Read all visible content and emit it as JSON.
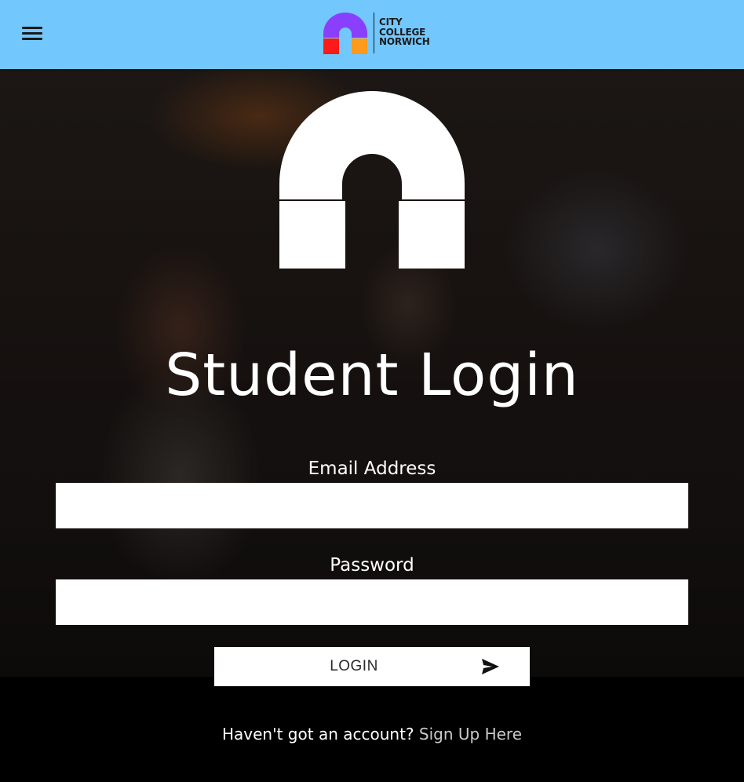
{
  "header": {
    "menu_icon": "hamburger-menu-icon",
    "logo": {
      "lines": [
        "CITY",
        "COLLEGE",
        "NORWICH"
      ],
      "colors": {
        "arch": "#8a3ffc",
        "left_block": "#ff1a1a",
        "right_block": "#ff9a1a"
      }
    },
    "background": "#72c7fd"
  },
  "hero": {
    "logo_icon": "city-college-arch-logo-icon",
    "title": "Student Login"
  },
  "form": {
    "email": {
      "label": "Email Address",
      "value": "",
      "placeholder": ""
    },
    "password": {
      "label": "Password",
      "value": "",
      "placeholder": ""
    },
    "login": {
      "label": "LOGIN",
      "icon": "send-arrow-icon"
    }
  },
  "footer": {
    "prompt": "Haven't got an account?",
    "link": "Sign Up Here"
  }
}
